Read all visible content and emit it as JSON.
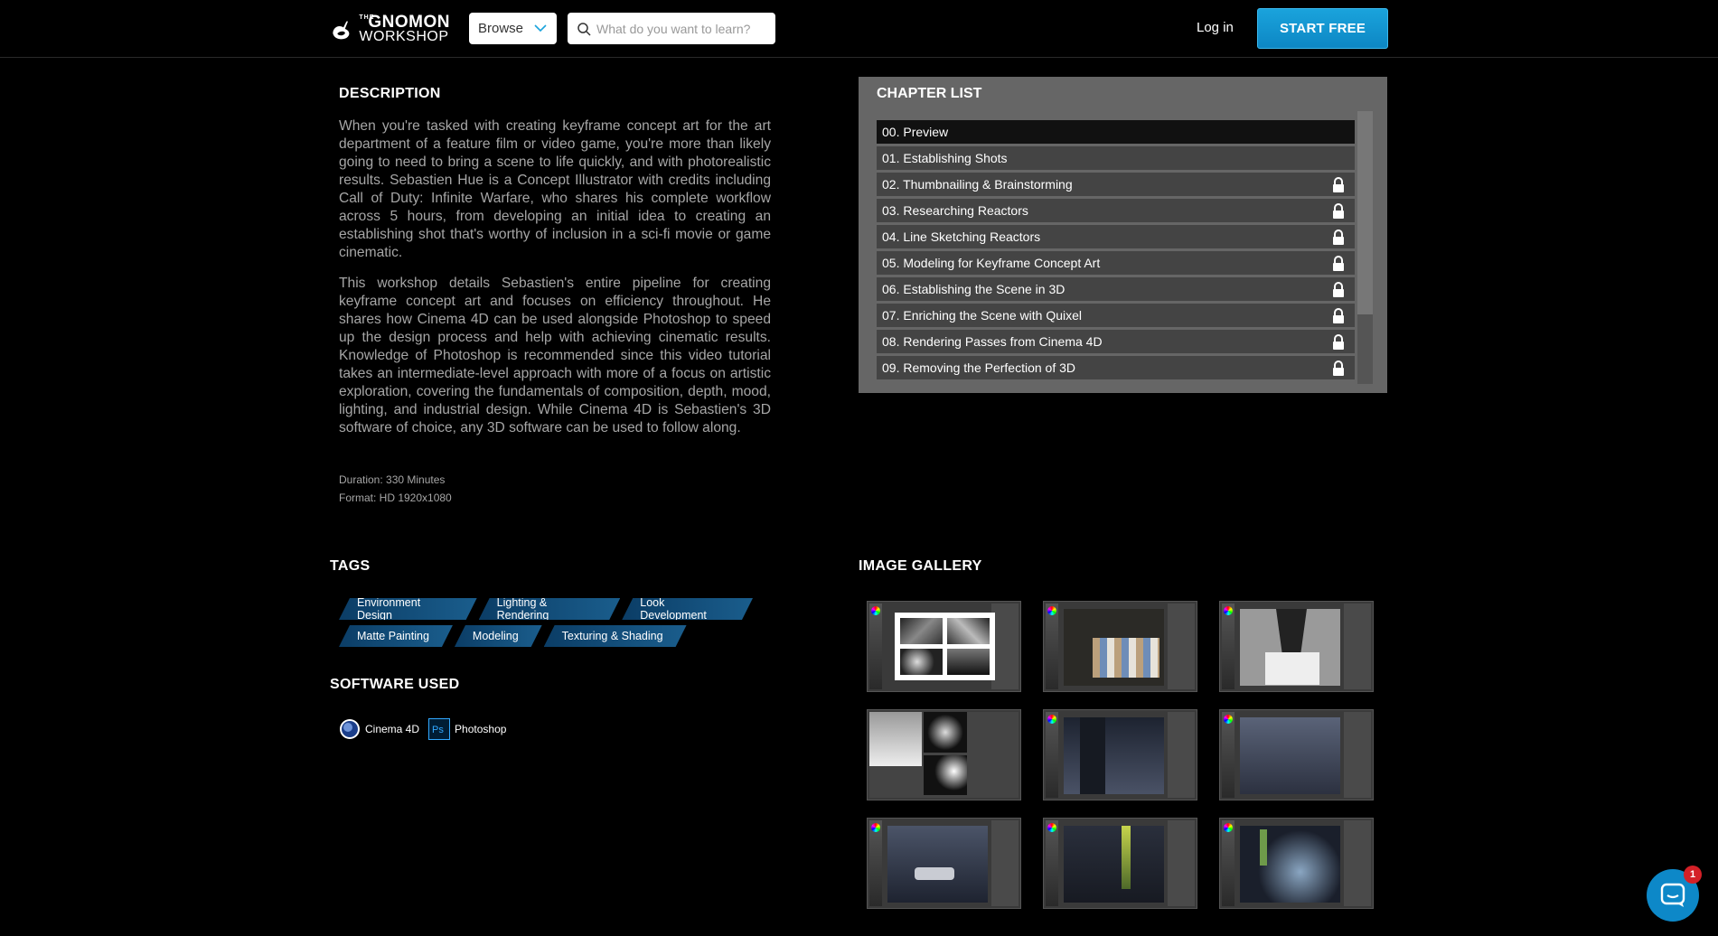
{
  "header": {
    "logo": {
      "the": "THE",
      "gnomon": "GNOMON",
      "workshop": "WORKSHOP"
    },
    "browse_label": "Browse",
    "search_placeholder": "What do you want to learn?",
    "login_label": "Log in",
    "start_free_label": "START FREE",
    "accent_color": "#1aa3dc"
  },
  "description": {
    "title": "DESCRIPTION",
    "paragraphs": [
      "When you're tasked with creating keyframe concept art for the art department of a feature film or video game, you're more than likely going to need to bring a scene to life quickly, and with photorealistic results. Sebastien Hue is a Concept Illustrator with credits including Call of Duty: Infinite Warfare, who shares his complete workflow across 5 hours, from developing an initial idea to creating an establishing shot that's worthy of inclusion in a sci-fi movie or game cinematic.",
      "This workshop details Sebastien's entire pipeline for creating keyframe concept art and focuses on efficiency throughout. He shares how Cinema 4D can be used alongside Photoshop to speed up the design process and help with achieving cinematic results. Knowledge of Photoshop is recommended since this video tutorial takes an intermediate-level approach with more of a focus on artistic exploration, covering the fundamentals of composition, depth, mood, lighting, and industrial design. While Cinema 4D is Sebastien's 3D software of choice, any 3D software can be used to follow along."
    ],
    "duration": "Duration: 330 Minutes",
    "format": "Format: HD 1920x1080"
  },
  "chapters": {
    "title": "CHAPTER LIST",
    "items": [
      {
        "label": "00. Preview",
        "locked": false,
        "active": true
      },
      {
        "label": "01. Establishing Shots",
        "locked": false,
        "active": false
      },
      {
        "label": "02. Thumbnailing & Brainstorming",
        "locked": true,
        "active": false
      },
      {
        "label": "03. Researching Reactors",
        "locked": true,
        "active": false
      },
      {
        "label": "04. Line Sketching Reactors",
        "locked": true,
        "active": false
      },
      {
        "label": "05. Modeling for Keyframe Concept Art",
        "locked": true,
        "active": false
      },
      {
        "label": "06. Establishing the Scene in 3D",
        "locked": true,
        "active": false
      },
      {
        "label": "07. Enriching the Scene with Quixel",
        "locked": true,
        "active": false
      },
      {
        "label": "08. Rendering Passes from Cinema 4D",
        "locked": true,
        "active": false
      },
      {
        "label": "09. Removing the Perfection of 3D",
        "locked": true,
        "active": false
      }
    ]
  },
  "tags": {
    "title": "TAGS",
    "rows": [
      [
        "Environment Design",
        "Lighting & Rendering",
        "Look Development"
      ],
      [
        "Matte Painting",
        "Modeling",
        "Texturing & Shading"
      ]
    ]
  },
  "software": {
    "title": "SOFTWARE USED",
    "items": [
      {
        "name": "Cinema 4D",
        "icon": "cinema4d-icon"
      },
      {
        "name": "Photoshop",
        "icon": "photoshop-icon"
      }
    ]
  },
  "gallery": {
    "title": "IMAGE GALLERY",
    "count": 9
  },
  "chat": {
    "badge": "1"
  }
}
